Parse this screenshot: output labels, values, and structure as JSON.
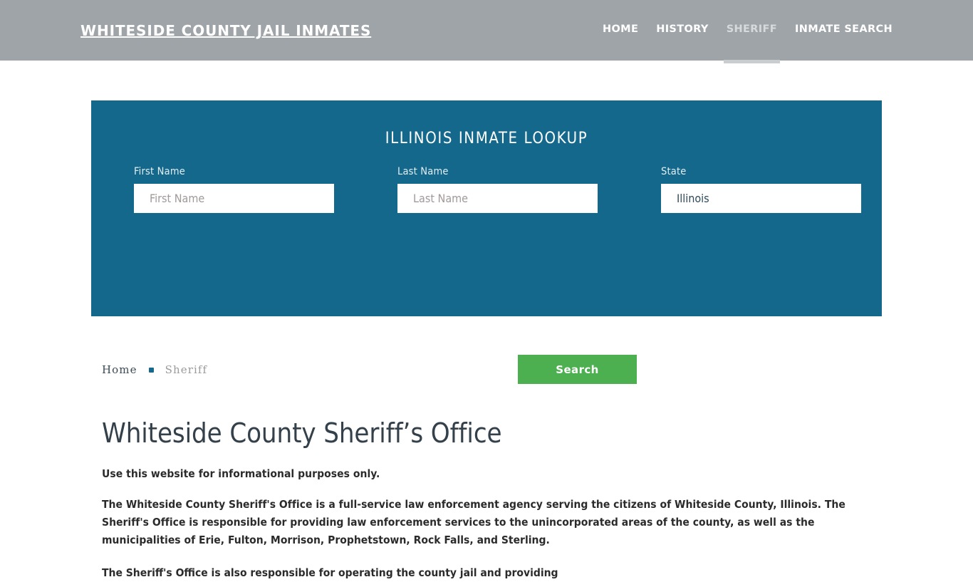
{
  "header": {
    "brand": "Whiteside County Jail Inmates",
    "background_color": "#9fa4a8",
    "nav": [
      {
        "label": "Home",
        "active": false
      },
      {
        "label": "History",
        "active": false
      },
      {
        "label": "Sheriff",
        "active": true
      },
      {
        "label": "Inmate Search",
        "active": false
      }
    ]
  },
  "lookup": {
    "title": "Illinois Inmate Lookup",
    "panel_color": "#14688c",
    "first_name": {
      "label": "First Name",
      "placeholder": "First Name",
      "value": ""
    },
    "last_name": {
      "label": "Last Name",
      "placeholder": "Last Name",
      "value": ""
    },
    "state": {
      "label": "State",
      "placeholder": "State",
      "value": "Illinois"
    },
    "search_button": {
      "label": "Search",
      "color": "#4caf50"
    }
  },
  "breadcrumb": {
    "home": "Home",
    "separator": "bullet-separator-icon",
    "current": "Sheriff"
  },
  "main": {
    "title": "Whiteside County Sheriff’s Office",
    "lede": "Use this website for informational purposes only.",
    "paragraph": "The Whiteside County Sheriff's Office is a full-service law enforcement agency serving the citizens of Whiteside County, Illinois. The Sheriff's Office is responsible for providing law enforcement services to the unincorporated areas of the county, as well as the municipalities of Erie, Fulton, Morrison, Prophetstown, Rock Falls, and Sterling.",
    "paragraph_cut_off": "The Sheriff's Office is also responsible for operating the county jail and providing"
  }
}
